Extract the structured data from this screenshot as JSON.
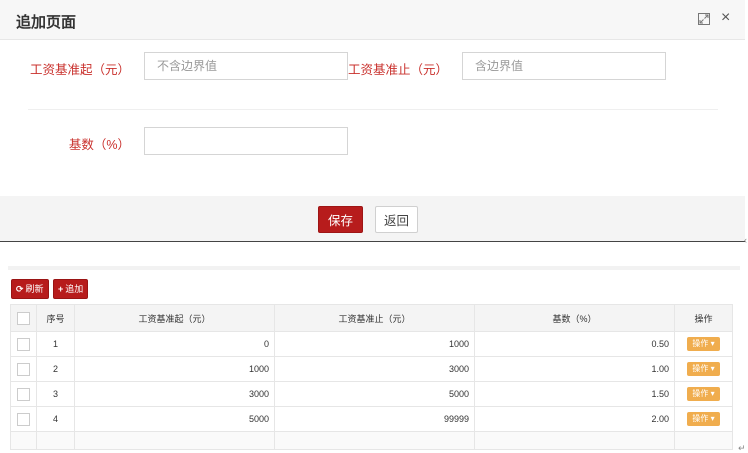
{
  "modal": {
    "title": "追加页面",
    "form": {
      "start_label": "工资基准起（元）",
      "start_placeholder": "不含边界值",
      "end_label": "工资基准止（元）",
      "end_placeholder": "含边界值",
      "base_label": "基数（%）",
      "base_value": ""
    },
    "footer": {
      "save_label": "保存",
      "back_label": "返回"
    }
  },
  "toolbar": {
    "refresh_label": "刷新",
    "add_label": "追加"
  },
  "table": {
    "headers": [
      "序号",
      "工资基准起（元）",
      "工资基准止（元）",
      "基数（%）",
      "操作"
    ],
    "rows": [
      {
        "no": "1",
        "start": "0",
        "end": "1000",
        "base": "0.50",
        "op": "操作"
      },
      {
        "no": "2",
        "start": "1000",
        "end": "3000",
        "base": "1.00",
        "op": "操作"
      },
      {
        "no": "3",
        "start": "3000",
        "end": "5000",
        "base": "1.50",
        "op": "操作"
      },
      {
        "no": "4",
        "start": "5000",
        "end": "99999",
        "base": "2.00",
        "op": "操作"
      }
    ]
  },
  "colors": {
    "accent_red": "#b71c1c",
    "label_red": "#c9302c",
    "op_orange": "#f0ad4e"
  },
  "icons": [
    "maximize-icon",
    "close-icon",
    "refresh-icon",
    "plus-icon",
    "caret-down-icon"
  ]
}
